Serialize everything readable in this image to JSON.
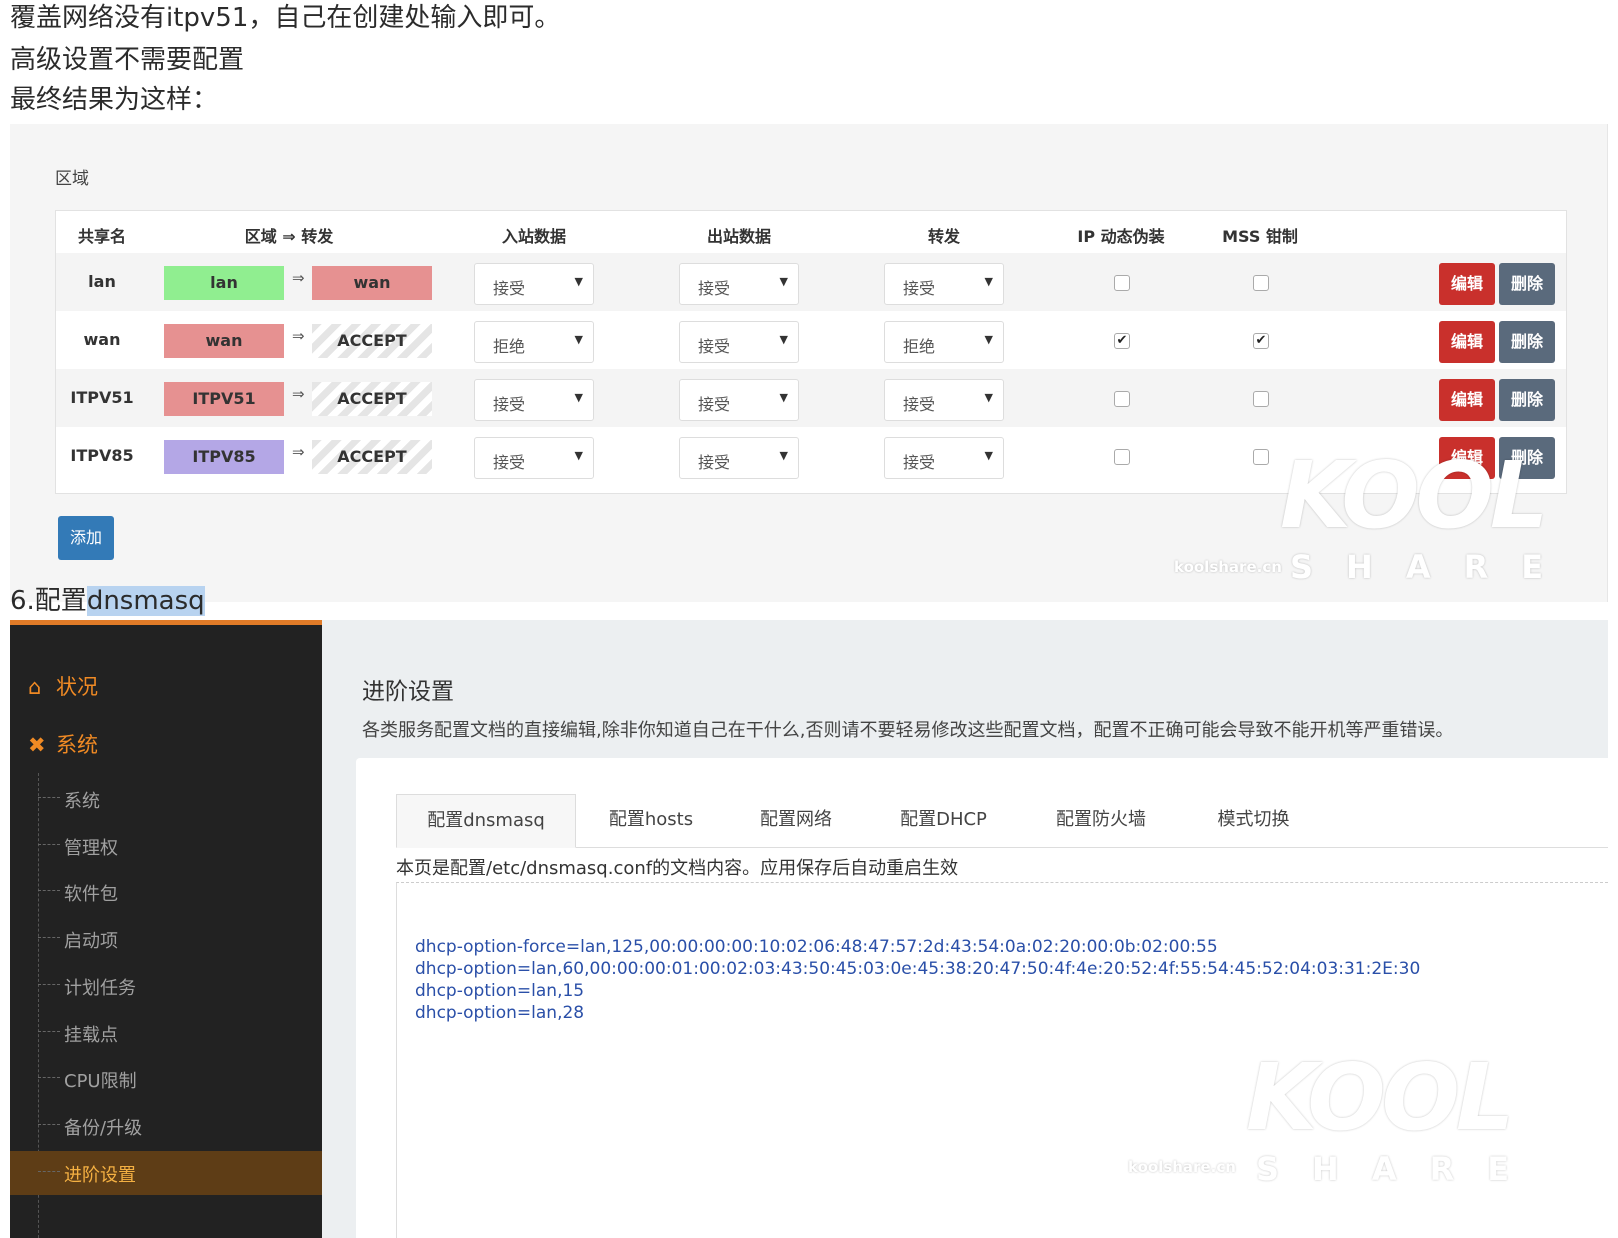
{
  "intro": {
    "line1": "覆盖网络没有itpv51，自己在创建处输入即可。",
    "line2": "高级设置不需要配置",
    "line3": "最终结果为这样："
  },
  "zones": {
    "section_title": "区域",
    "headers": {
      "name": "共享名",
      "zone_forward": "区域 ⇒ 转发",
      "input": "入站数据",
      "output": "出站数据",
      "forward": "转发",
      "masq": "IP 动态伪装",
      "mss": "MSS 钳制"
    },
    "rows": [
      {
        "name": "lan",
        "zone": "lan",
        "zone_color": "#90ee90",
        "arrow": "⇒",
        "forward_to": "wan",
        "forward_color": "#e69191",
        "input": "接受",
        "output": "接受",
        "forward": "接受",
        "masq": "",
        "mss": ""
      },
      {
        "name": "wan",
        "zone": "wan",
        "zone_color": "#e69191",
        "arrow": "⇒",
        "forward_to": "ACCEPT",
        "forward_color": "",
        "input": "拒绝",
        "output": "接受",
        "forward": "拒绝",
        "masq": "✔",
        "mss": "✔"
      },
      {
        "name": "ITPV51",
        "zone": "ITPV51",
        "zone_color": "#e69191",
        "arrow": "⇒",
        "forward_to": "ACCEPT",
        "forward_color": "",
        "input": "接受",
        "output": "接受",
        "forward": "接受",
        "masq": "",
        "mss": ""
      },
      {
        "name": "ITPV85",
        "zone": "ITPV85",
        "zone_color": "#b4a7e6",
        "arrow": "⇒",
        "forward_to": "ACCEPT",
        "forward_color": "",
        "input": "接受",
        "output": "接受",
        "forward": "接受",
        "masq": "",
        "mss": ""
      }
    ],
    "edit_label": "编辑",
    "delete_label": "删除",
    "add_label": "添加",
    "dropdown_icon": "caret-down-icon"
  },
  "watermark": {
    "kool": "KOOL",
    "share": "SHARE",
    "site": "koolshare.cn"
  },
  "heading6": {
    "prefix": "6.配置",
    "highlight": "dnsmasq"
  },
  "admin": {
    "accent": "#f08a24",
    "sidebar": {
      "top_items": [
        {
          "label": "状况",
          "icon": "home-icon"
        },
        {
          "label": "系统",
          "icon": "tools-icon"
        }
      ],
      "sub_items": [
        {
          "label": "系统"
        },
        {
          "label": "管理权"
        },
        {
          "label": "软件包"
        },
        {
          "label": "启动项"
        },
        {
          "label": "计划任务"
        },
        {
          "label": "挂载点"
        },
        {
          "label": "CPU限制"
        },
        {
          "label": "备份/升级"
        },
        {
          "label": "进阶设置",
          "active": true
        }
      ]
    },
    "title": "进阶设置",
    "description": "各类服务配置文档的直接编辑,除非你知道自己在干什么,否则请不要轻易修改这些配置文档，配置不正确可能会导致不能开机等严重错误。",
    "tabs": [
      {
        "label": "配置dnsmasq",
        "active": true
      },
      {
        "label": "配置hosts"
      },
      {
        "label": "配置网络"
      },
      {
        "label": "配置DHCP"
      },
      {
        "label": "配置防火墙"
      },
      {
        "label": "模式切换"
      }
    ],
    "note": "本页是配置/etc/dnsmasq.conf的文档内容。应用保存后自动重启生效",
    "editor_lines": [
      "dhcp-option-force=lan,125,00:00:00:00:10:02:06:48:47:57:2d:43:54:0a:02:20:00:0b:02:00:55",
      "dhcp-option=lan,60,00:00:00:01:00:02:03:43:50:45:03:0e:45:38:20:47:50:4f:4e:20:52:4f:55:54:45:52:04:03:31:2E:30",
      "dhcp-option=lan,15",
      "dhcp-option=lan,28"
    ]
  }
}
